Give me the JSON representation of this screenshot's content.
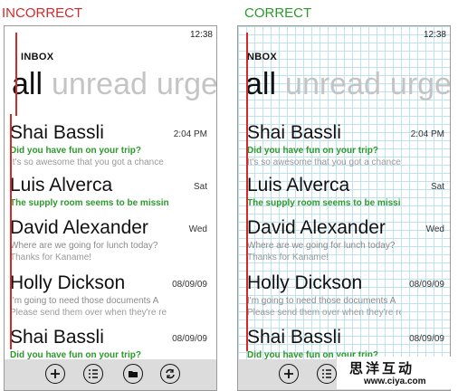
{
  "headings": {
    "incorrect": "INCORRECT",
    "correct": "CORRECT",
    "incorrect_color": "#d3292b",
    "correct_color": "#2b9a2b"
  },
  "phone": {
    "time": "12:38",
    "inbox_label": "INBOX",
    "inbox_label_cropped": "NBOX",
    "pivots": [
      "all",
      "unread",
      "urgent"
    ],
    "pivot_visible_urgent": "urger"
  },
  "messages": [
    {
      "sender": "Shai Bassli",
      "date": "2:04 PM",
      "subject": "Did you have fun on your trip?",
      "subject_style": "green",
      "preview": "It's so awesome that you got a chance"
    },
    {
      "sender": "Luis Alverca",
      "date": "Sat",
      "subject": "The supply room seems to be missing",
      "subject_style": "green",
      "preview": ""
    },
    {
      "sender": "David Alexander",
      "date": "Wed",
      "subject": "Where are we going for lunch today?",
      "subject_style": "gray",
      "preview": "Thanks for Kaname!"
    },
    {
      "sender": "Holly Dickson",
      "date": "08/09/09",
      "subject": "I'm going to need those documents A",
      "subject_style": "gray",
      "preview": "Please send them over when they're re"
    },
    {
      "sender": "Shai Bassli",
      "date": "08/09/09",
      "subject": "Did you have fun on your trip?",
      "subject_style": "green",
      "preview": ""
    }
  ],
  "appbar": {
    "buttons": [
      {
        "name": "add-icon"
      },
      {
        "name": "select-icon"
      },
      {
        "name": "folder-icon"
      },
      {
        "name": "sync-icon"
      }
    ]
  },
  "watermark": {
    "chinese": "思洋互动",
    "url": "www.ciya.com"
  }
}
